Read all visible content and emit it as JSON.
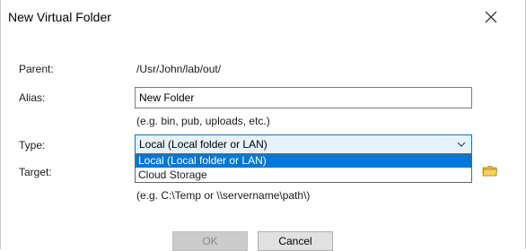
{
  "dialog": {
    "title": "New Virtual Folder",
    "close_glyph": "✕"
  },
  "form": {
    "parent": {
      "label": "Parent:",
      "value": "/Usr/John/lab/out/"
    },
    "alias": {
      "label": "Alias:",
      "value": "New Folder",
      "hint": "(e.g. bin, pub, uploads, etc.)"
    },
    "type": {
      "label": "Type:",
      "selected": "Local (Local folder or LAN)",
      "options": [
        "Local (Local folder or LAN)",
        "Cloud Storage"
      ],
      "highlighted_index": 0
    },
    "target": {
      "label": "Target:",
      "hint": "(e.g. C:\\Temp  or  \\\\servername\\path\\)",
      "browse_icon": "folder-icon"
    }
  },
  "buttons": {
    "ok_label": "OK",
    "ok_enabled": false,
    "cancel_label": "Cancel"
  },
  "colors": {
    "accent": "#0078d7",
    "folder": "#e8b93a"
  }
}
